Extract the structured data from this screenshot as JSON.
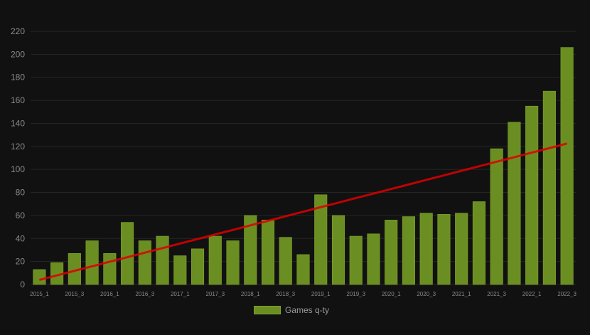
{
  "colors": {
    "background": "#111111",
    "grid": "#262626",
    "bar_fill": "#6b8e23",
    "bar_stroke": "#7fa52a",
    "trend_line": "#dd0000",
    "tick_text": "#8a8a8a",
    "legend_text": "#9a9a9a"
  },
  "legend": {
    "label": "Games q-ty"
  },
  "chart_data": {
    "type": "bar",
    "categories": [
      "2015_1",
      "2015_2",
      "2015_3",
      "2015_4",
      "2016_1",
      "2016_2",
      "2016_3",
      "2016_4",
      "2017_1",
      "2017_2",
      "2017_3",
      "2017_4",
      "2018_1",
      "2018_2",
      "2018_3",
      "2018_4",
      "2019_1",
      "2019_2",
      "2019_3",
      "2019_4",
      "2020_1",
      "2020_2",
      "2020_3",
      "2020_4",
      "2021_1",
      "2021_2",
      "2021_3",
      "2021_4",
      "2022_1",
      "2022_2",
      "2022_3"
    ],
    "visible_x_ticks": [
      "2015_1",
      "2015_3",
      "2016_1",
      "2016_3",
      "2017_1",
      "2017_3",
      "2018_1",
      "2018_3",
      "2019_1",
      "2019_3",
      "2020_1",
      "2020_3",
      "2021_1",
      "2021_3",
      "2022_1",
      "2022_3"
    ],
    "series": [
      {
        "name": "Games q-ty",
        "type": "bar",
        "values": [
          13,
          19,
          27,
          38,
          27,
          54,
          38,
          42,
          25,
          31,
          42,
          38,
          60,
          56,
          41,
          26,
          78,
          60,
          42,
          44,
          56,
          59,
          62,
          61,
          62,
          72,
          118,
          141,
          155,
          168,
          206
        ]
      },
      {
        "type": "line",
        "role": "trend",
        "values": [
          4,
          7.9,
          11.9,
          15.8,
          19.8,
          23.7,
          27.7,
          31.6,
          35.6,
          39.5,
          43.5,
          47.4,
          51.4,
          55.3,
          59.3,
          63.2,
          67.2,
          71.1,
          75.1,
          79,
          83,
          86.9,
          90.9,
          94.8,
          98.8,
          102.7,
          106.7,
          110.6,
          114.6,
          118.5,
          122.5
        ]
      }
    ],
    "ylim": [
      0,
      220
    ],
    "yticks": [
      0,
      20,
      40,
      60,
      80,
      100,
      120,
      140,
      160,
      180,
      200,
      220
    ],
    "grid": true,
    "legend_position": "bottom"
  }
}
